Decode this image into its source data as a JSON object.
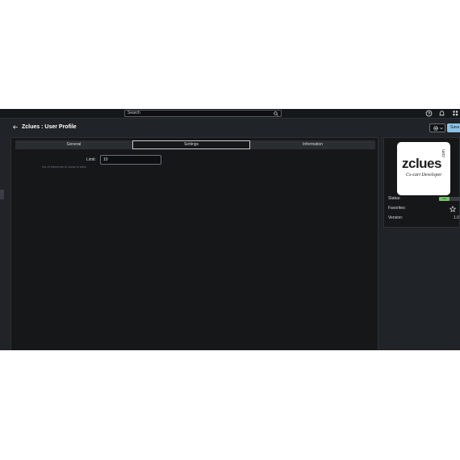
{
  "topbar": {
    "search_placeholder": "Search",
    "icons": [
      "search-icon",
      "help-icon",
      "bell-icon",
      "grid-icon"
    ]
  },
  "header": {
    "title": "Zclues : User Profile",
    "save_label": "Save"
  },
  "tabs": [
    {
      "label": "General",
      "active": false
    },
    {
      "label": "Settings",
      "active": true
    },
    {
      "label": "Information",
      "active": false
    }
  ],
  "settings": {
    "limit_label": "Limit:",
    "limit_value": "10",
    "limit_help": "No of elements to show in tabs"
  },
  "app_info": {
    "logo_name": "zclues",
    "logo_domain": ".com",
    "logo_tagline": "Cs-cart Developer",
    "status_label": "Status:",
    "status_value": "ON",
    "favorites_label": "Favorites:",
    "version_label": "Version:",
    "version_value": "1.0"
  },
  "colors": {
    "background": "#202327",
    "panel": "#151719",
    "accent": "#8ec3e6",
    "status_on": "#79c46a"
  }
}
